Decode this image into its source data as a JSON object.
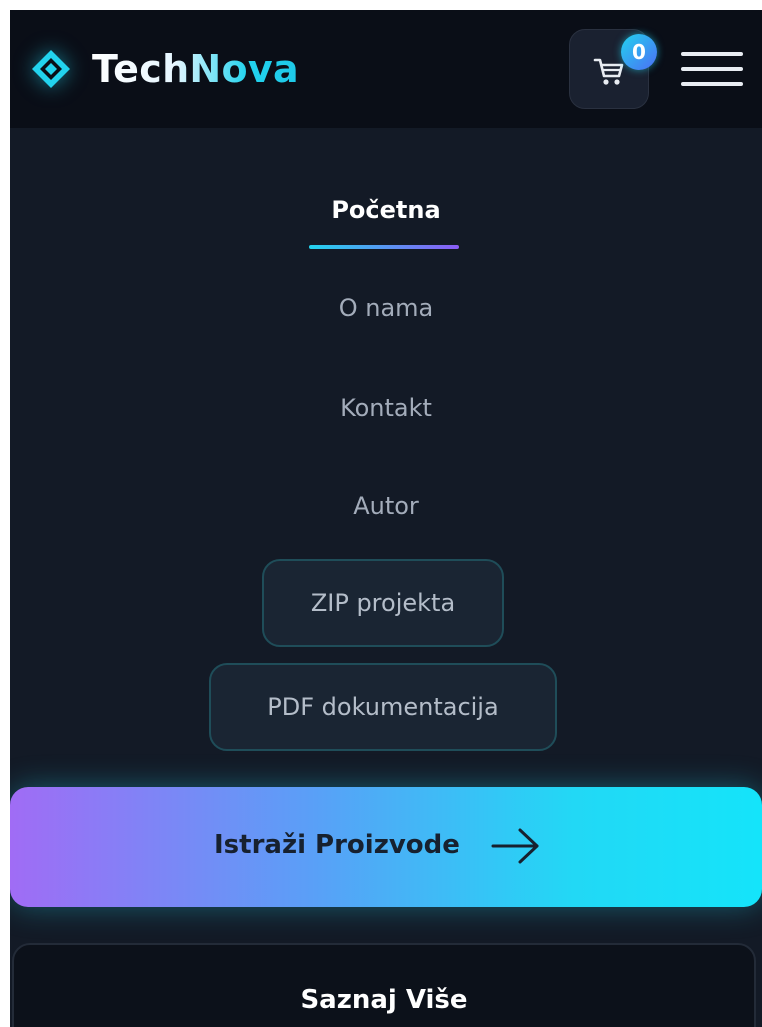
{
  "header": {
    "brand_name": "TechNova",
    "brand_icon": "diamond-logo-icon",
    "cart_icon": "cart-icon",
    "cart_count": "0",
    "menu_icon": "hamburger-menu-icon"
  },
  "nav": {
    "items": [
      {
        "label": "Početna",
        "active": true
      },
      {
        "label": "O nama",
        "active": false
      },
      {
        "label": "Kontakt",
        "active": false
      },
      {
        "label": "Autor",
        "active": false
      }
    ],
    "zip_label": "ZIP projekta",
    "pdf_label": "PDF dokumentacija"
  },
  "hero": {
    "primary_label": "Istraži Proizvode",
    "primary_icon": "arrow-right-icon",
    "secondary_label": "Saznaj Više"
  },
  "colors": {
    "accent_cyan": "#22d3ee",
    "accent_purple": "#8b5cf6",
    "background": "#131a26",
    "header_background": "#0a0e17"
  }
}
